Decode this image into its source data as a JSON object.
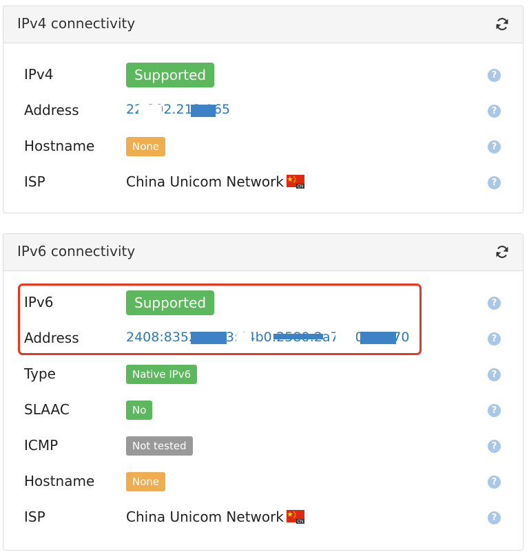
{
  "ipv4": {
    "title": "IPv4 connectivity",
    "rows": {
      "status": {
        "label": "IPv4",
        "value": "Supported"
      },
      "address": {
        "label": "Address",
        "value": "22.202.212.165"
      },
      "hostname": {
        "label": "Hostname",
        "value": "None"
      },
      "isp": {
        "label": "ISP",
        "value": "China Unicom Network"
      }
    }
  },
  "ipv6": {
    "title": "IPv6 connectivity",
    "rows": {
      "status": {
        "label": "IPv6",
        "value": "Supported"
      },
      "address": {
        "label": "Address",
        "value": "2408:8352:4ae3:44b0:2580:2a7e807:5670"
      },
      "type": {
        "label": "Type",
        "value": "Native IPv6"
      },
      "slaac": {
        "label": "SLAAC",
        "value": "No"
      },
      "icmp": {
        "label": "ICMP",
        "value": "Not tested"
      },
      "hostname": {
        "label": "Hostname",
        "value": "None"
      },
      "isp": {
        "label": "ISP",
        "value": "China Unicom Network"
      }
    }
  },
  "help_glyph": "?",
  "flag_code": "CN",
  "colors": {
    "success": "#5cb85c",
    "warning": "#f0ad4e",
    "neutral": "#999999",
    "link": "#2a7ac2",
    "highlight": "#e8361f"
  }
}
